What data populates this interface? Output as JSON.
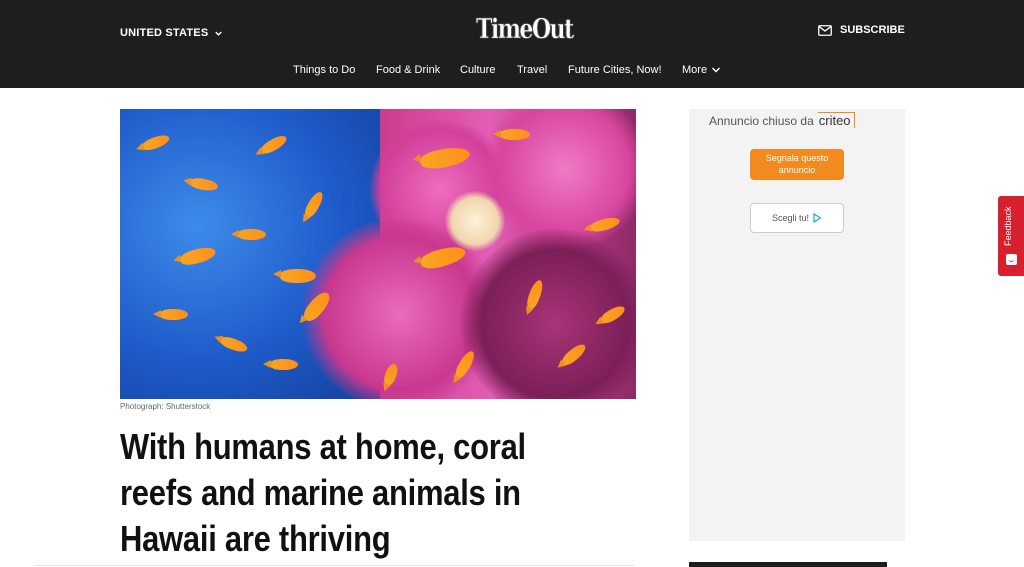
{
  "header": {
    "region_label": "UNITED STATES",
    "logo_text": "TimeOut",
    "subscribe_label": "SUBSCRIBE",
    "nav": [
      "Things to Do",
      "Food & Drink",
      "Culture",
      "Travel",
      "Future Cities, Now!",
      "More"
    ]
  },
  "article": {
    "photo_credit": "Photograph: Shutterstock",
    "headline": "With humans at home, coral reefs and marine animals in Hawaii are thriving"
  },
  "ad": {
    "closed_by": "Annuncio chiuso da",
    "brand": "criteo",
    "report_button": "Segnala questo annuncio",
    "choose_button": "Scegli tu!"
  },
  "feedback_tab": {
    "label": "Feedback"
  },
  "colors": {
    "header_bg": "#1e1e1e",
    "ad_accent": "#f28a1f",
    "feedback_bg": "#d6202e"
  }
}
